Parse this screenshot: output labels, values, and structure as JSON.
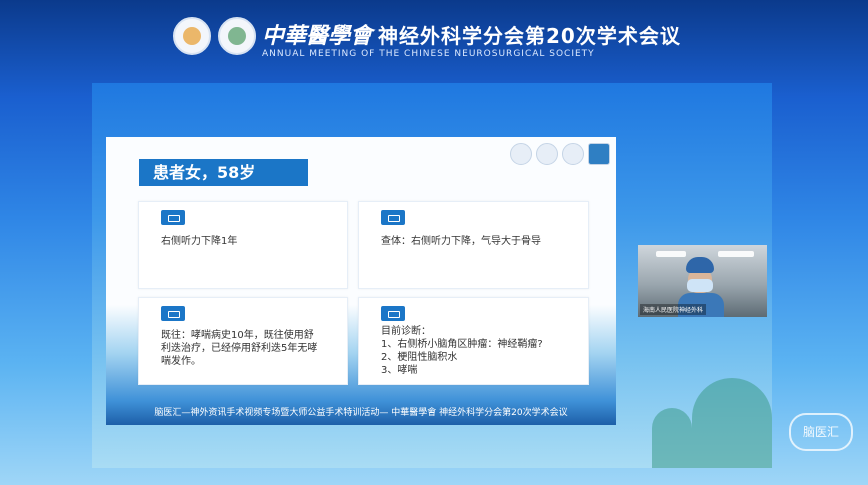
{
  "banner": {
    "calligraphy": "中華醫學會",
    "title": "神经外科学分会第20次学术会议",
    "subtitle": "ANNUAL MEETING OF THE CHINESE NEUROSURGICAL SOCIETY"
  },
  "slide": {
    "title": "患者女，58岁",
    "cards": [
      {
        "icon": "monitor-icon",
        "lines": [
          "右侧听力下降1年"
        ]
      },
      {
        "icon": "keyboard-icon",
        "lines": [
          "查体：右侧听力下降，气导大于骨导"
        ]
      },
      {
        "icon": "folder-icon",
        "lines": [
          "既往：哮喘病史10年，既往使用舒",
          "利迭治疗，已经停用舒利迭5年无哮",
          "喘发作。"
        ]
      },
      {
        "icon": "document-icon",
        "lines": [
          "目前诊断：",
          "1、右侧桥小脑角区肿瘤：神经鞘瘤?",
          "2、梗阻性脑积水",
          "3、哮喘"
        ]
      }
    ],
    "footer": "脑医汇—神外资讯手术视频专场暨大师公益手术特训活动— 中華醫學會 神经外科学分会第20次学术会议"
  },
  "video": {
    "name": "海南人民医院神经外科"
  },
  "watermark": "脑医汇",
  "colors": {
    "accent": "#1b76c7",
    "background_top": "#0b3a8c",
    "background_bottom": "#9fd6f7"
  }
}
